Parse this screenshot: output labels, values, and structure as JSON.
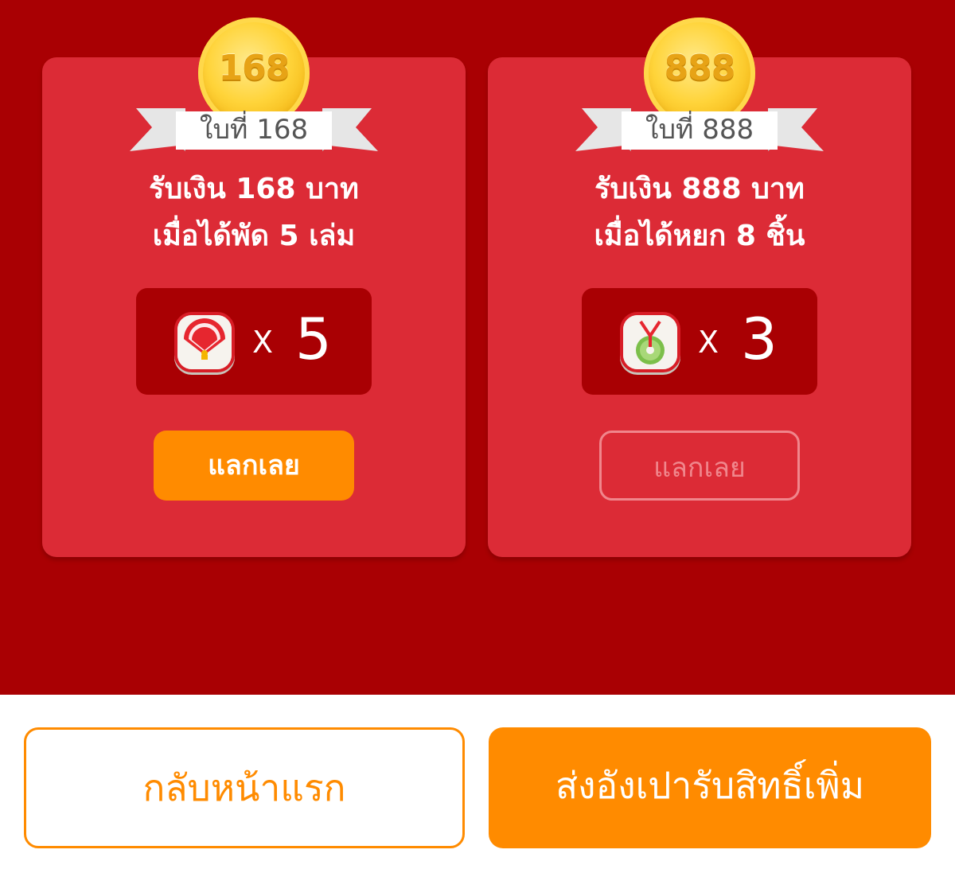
{
  "colors": {
    "background_red": "#a90003",
    "card_red": "#dc2b36",
    "accent_orange": "#ff8b00",
    "coin_gold": "#ffd43a",
    "disabled_pink": "#f0868c"
  },
  "rewards": [
    {
      "coin_value": "168",
      "ribbon_label": "ใบที่ 168",
      "line1": "รับเงิน 168 บาท",
      "line2": "เมื่อได้พัด 5 เล่ม",
      "item_icon": "fan-icon",
      "times_symbol": "X",
      "count": "5",
      "redeem_label": "แลกเลย",
      "redeem_state": "active"
    },
    {
      "coin_value": "888",
      "ribbon_label": "ใบที่ 888",
      "line1": "รับเงิน 888 บาท",
      "line2": "เมื่อได้หยก 8 ชิ้น",
      "item_icon": "jade-pendant-icon",
      "times_symbol": "X",
      "count": "3",
      "redeem_label": "แลกเลย",
      "redeem_state": "disabled"
    }
  ],
  "footer": {
    "back_label": "กลับหน้าแรก",
    "send_label": "ส่งอังเปารับสิทธิ์เพิ่ม"
  }
}
